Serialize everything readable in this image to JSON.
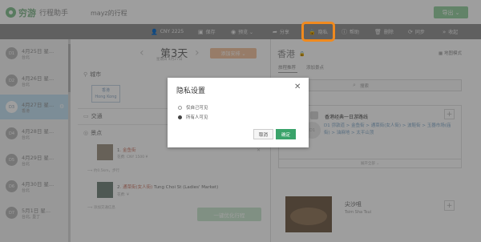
{
  "header": {
    "logo_text": "穷游",
    "logo_sub": "行程助手",
    "trip_title": "mayz的行程",
    "export_label": "导出 ⌄"
  },
  "toolbar": {
    "items": [
      {
        "icon": "person-icon",
        "glyph": "👤",
        "label": "CNY 2225"
      },
      {
        "icon": "save-icon",
        "glyph": "▣",
        "label": "保存"
      },
      {
        "icon": "eye-icon",
        "glyph": "◉",
        "label": "预览 ⌄"
      },
      {
        "icon": "share-icon",
        "glyph": "➦",
        "label": "分享"
      },
      {
        "icon": "lock-icon",
        "glyph": "🔒",
        "label": "隐私"
      },
      {
        "icon": "help-icon",
        "glyph": "ⓘ",
        "label": "帮助"
      },
      {
        "icon": "trash-icon",
        "glyph": "🗑",
        "label": "删除"
      },
      {
        "icon": "sync-icon",
        "glyph": "⟳",
        "label": "同步"
      },
      {
        "icon": "collapse-icon",
        "glyph": "»",
        "label": "收起"
      }
    ]
  },
  "days": [
    {
      "num": "D1",
      "date": "4月25日 星...",
      "city": "台北"
    },
    {
      "num": "D2",
      "date": "4月26日 星...",
      "city": "台北"
    },
    {
      "num": "D3",
      "date": "4月27日 星...",
      "city": "香港"
    },
    {
      "num": "D4",
      "date": "4月28日 星...",
      "city": "台北"
    },
    {
      "num": "D5",
      "date": "4月29日 星...",
      "city": "台北"
    },
    {
      "num": "D6",
      "date": "4月30日 星...",
      "city": "台北"
    },
    {
      "num": "D7",
      "date": "5月1日 星...",
      "city": "台北, 垦丁"
    }
  ],
  "middle": {
    "day_title": "第3天",
    "day_sub": "星期日 4月27日",
    "add_btn": "添加安排 ⌄",
    "section_city": "城市",
    "city_tag_cn": "香港",
    "city_tag_en": "Hong Kong",
    "section_traffic": "交通",
    "section_poi": "景点",
    "poi": [
      {
        "index": "1",
        "name": "金鱼街",
        "sub": "花费: CNY 1500 ¥"
      },
      {
        "index": "2",
        "name": "通菜街(女人街)",
        "name_en": "Tung Choi St (Ladies' Market)",
        "sub": "花费: ¥"
      }
    ],
    "dist_1": "⟶ 约0.5km，步行",
    "dist_2": "⟶ 添加交通信息",
    "optimize_btn": "一键优化行程"
  },
  "right": {
    "city": "香港",
    "map_mode": "地图模式",
    "tab1": "旅程推荐",
    "tab2": "添加景点",
    "search_placeholder": "搜索",
    "card_title": "香港经典一日游路线",
    "card_day": "D1",
    "card_route": "D1  弥敦道 > 金鱼街 > 通菜街(女人街) > 波鞋街 > 玉器市场(庙街) > 油麻地 > 太平山顶",
    "more": "展开全部 ⌄",
    "poi_title": "尖沙咀",
    "poi_en": "Tsim Sha Tsui"
  },
  "modal": {
    "title": "隐私设置",
    "close": "✕",
    "option1": "仅自己可见",
    "option2": "所有人可见",
    "selected": "option2",
    "cancel": "取消",
    "confirm": "确定"
  },
  "colors": {
    "highlight": "#f08a1f",
    "confirm_green": "#3aa36a",
    "active_day": "#c9e4f4"
  }
}
